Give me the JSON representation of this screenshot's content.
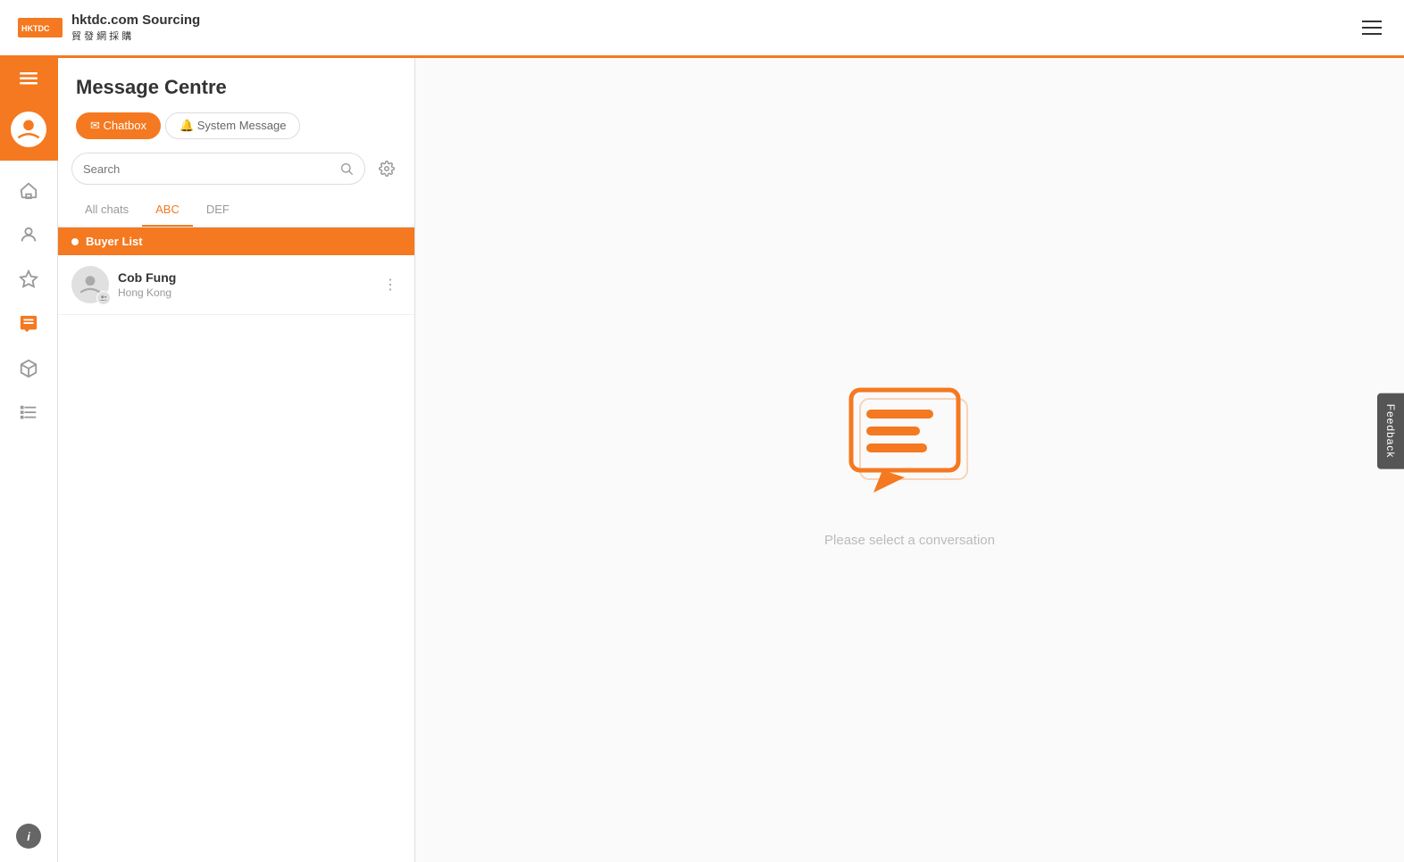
{
  "brand": {
    "logo_text": "HKTDC",
    "name_en": "hktdc.com Sourcing",
    "name_zh": "貿 發 網 採 購"
  },
  "header": {
    "title": "Message Centre",
    "tabs": [
      {
        "id": "chatbox",
        "label": "Chatbox",
        "active": true,
        "icon": "chat"
      },
      {
        "id": "system",
        "label": "System Message",
        "active": false,
        "icon": "bell"
      }
    ]
  },
  "search": {
    "placeholder": "Search"
  },
  "filter_tabs": [
    {
      "id": "all",
      "label": "All chats",
      "active": false
    },
    {
      "id": "abc",
      "label": "ABC",
      "active": true
    },
    {
      "id": "def",
      "label": "DEF",
      "active": false
    }
  ],
  "buyer_list": {
    "label": "Buyer List"
  },
  "contacts": [
    {
      "name": "Cob Fung",
      "location": "Hong Kong"
    }
  ],
  "empty_state": {
    "text": "Please select a conversation"
  },
  "sidebar_nav": [
    {
      "id": "home",
      "icon": "home",
      "active": false
    },
    {
      "id": "user",
      "icon": "user",
      "active": false
    },
    {
      "id": "star",
      "icon": "star",
      "active": false
    },
    {
      "id": "chat",
      "icon": "chat",
      "active": true
    },
    {
      "id": "cube",
      "icon": "cube",
      "active": false
    },
    {
      "id": "list",
      "icon": "list",
      "active": false
    }
  ],
  "feedback": {
    "label": "Feedback"
  }
}
